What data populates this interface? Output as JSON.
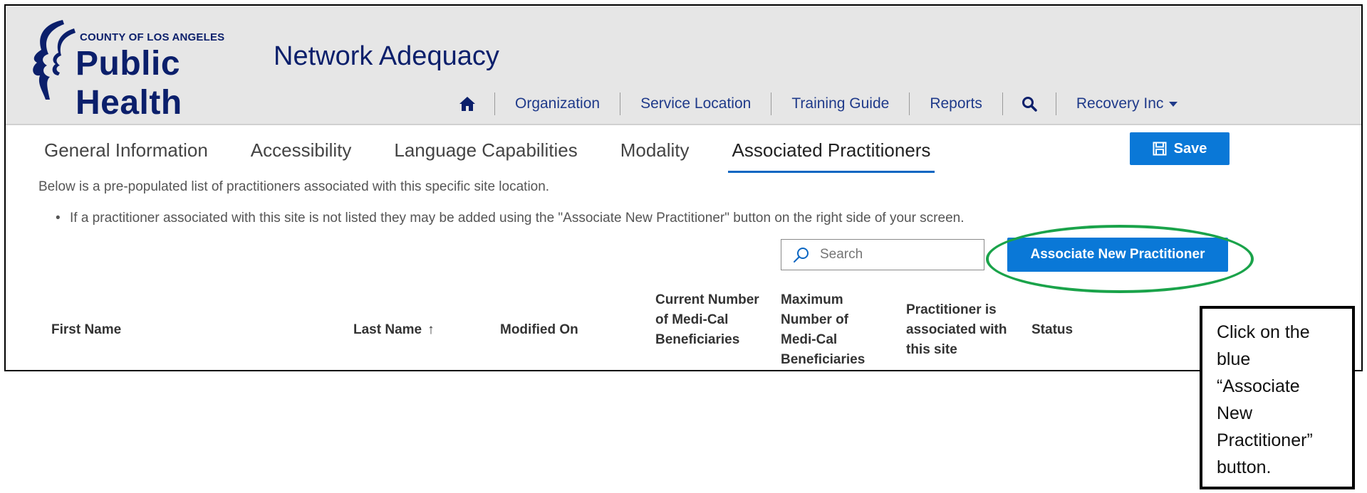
{
  "header": {
    "logo_small": "COUNTY OF LOS ANGELES",
    "logo_big": "Public Health",
    "app_title": "Network Adequacy",
    "nav": [
      {
        "label": "",
        "icon": "home-icon"
      },
      {
        "label": "Organization"
      },
      {
        "label": "Service Location"
      },
      {
        "label": "Training Guide"
      },
      {
        "label": "Reports"
      },
      {
        "label": "",
        "icon": "search-icon"
      },
      {
        "label": "Recovery Inc",
        "icon": "caret-down-icon"
      }
    ]
  },
  "tabs": [
    {
      "label": "General Information",
      "active": false
    },
    {
      "label": "Accessibility",
      "active": false
    },
    {
      "label": "Language Capabilities",
      "active": false
    },
    {
      "label": "Modality",
      "active": false
    },
    {
      "label": "Associated Practitioners",
      "active": true
    }
  ],
  "save_label": "Save",
  "intro_text": "Below is a pre-populated list of practitioners associated with this specific site location.",
  "bullet_text": "If a practitioner associated with this site is not listed they may be added using the \"Associate New Practitioner\" button on the right side of your screen.",
  "search": {
    "placeholder": "Search"
  },
  "associate_button": "Associate New Practitioner",
  "table": {
    "columns": [
      {
        "label": "First Name"
      },
      {
        "label": "Last Name",
        "sort": "↑"
      },
      {
        "label": "Modified On"
      },
      {
        "label": "Current Number of Medi-Cal Beneficiaries"
      },
      {
        "label": "Maximum Number of Medi-Cal Beneficiaries"
      },
      {
        "label": "Practitioner is associated with this site"
      },
      {
        "label": "Status"
      }
    ]
  },
  "callout_text": "Click on the blue “Associate New Practitioner” button.",
  "colors": {
    "brand_navy": "#0b1f6b",
    "primary_blue": "#0a78d7",
    "highlight_green": "#1aa34a"
  }
}
